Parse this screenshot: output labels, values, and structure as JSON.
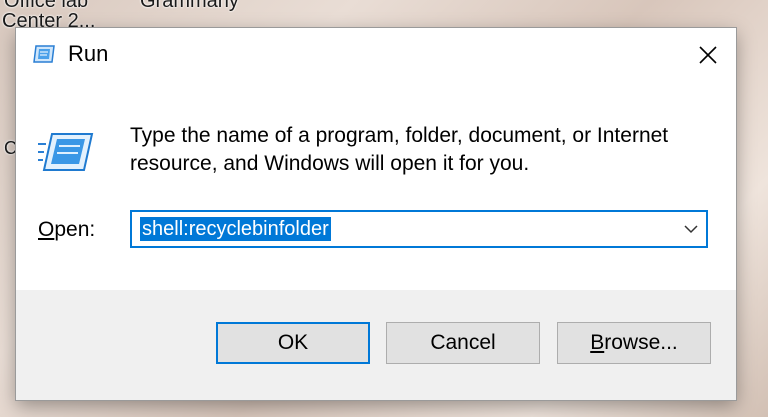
{
  "desktop": {
    "labels": [
      "Office lab",
      "Grammarly",
      "Center 2...",
      "C"
    ]
  },
  "dialog": {
    "title": "Run",
    "description": "Type the name of a program, folder, document, or Internet resource, and Windows will open it for you.",
    "open_label_accel": "O",
    "open_label_rest": "pen:",
    "open_value": "shell:recyclebinfolder"
  },
  "buttons": {
    "ok": "OK",
    "cancel": "Cancel",
    "browse_accel": "B",
    "browse_rest": "rowse..."
  },
  "colors": {
    "accent": "#0078d7",
    "footer_bg": "#f0f0f0",
    "button_bg": "#e1e1e1"
  },
  "icons": {
    "title": "run-icon",
    "close": "close-icon",
    "dropdown": "chevron-down-icon"
  }
}
